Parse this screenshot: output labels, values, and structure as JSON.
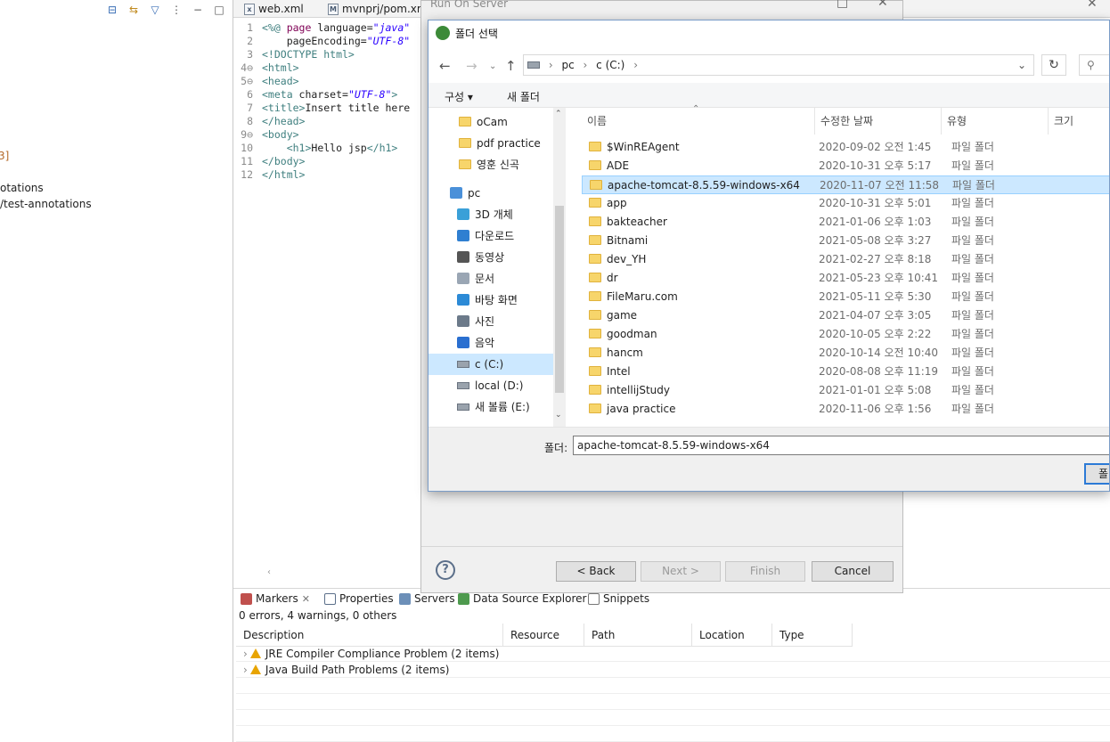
{
  "left_panel": {
    "items": [
      "3]",
      "otations",
      "/test-annotations"
    ]
  },
  "editor": {
    "tabs": [
      "web.xml",
      "mvnprj/pom.xm"
    ],
    "lines": [
      {
        "num": "1",
        "segments": [
          [
            "tag",
            "<%@ "
          ],
          [
            "kw",
            "page "
          ],
          [
            "",
            "language="
          ],
          [
            "str",
            "\"java\""
          ]
        ]
      },
      {
        "num": "2",
        "segments": [
          [
            "",
            "    pageEncoding="
          ],
          [
            "str",
            "\"UTF-8\""
          ]
        ]
      },
      {
        "num": "3",
        "segments": [
          [
            "tag",
            "<!DOCTYPE html>"
          ]
        ]
      },
      {
        "num": "4⊖",
        "segments": [
          [
            "tag",
            "<html>"
          ]
        ]
      },
      {
        "num": "5⊖",
        "segments": [
          [
            "tag",
            "<head>"
          ]
        ]
      },
      {
        "num": "6",
        "segments": [
          [
            "tag",
            "<meta "
          ],
          [
            "",
            "charset="
          ],
          [
            "str",
            "\"UTF-8\""
          ],
          [
            "tag",
            ">"
          ]
        ]
      },
      {
        "num": "7",
        "segments": [
          [
            "tag",
            "<title>"
          ],
          [
            "",
            "Insert title here"
          ]
        ]
      },
      {
        "num": "8",
        "segments": [
          [
            "tag",
            "</head>"
          ]
        ]
      },
      {
        "num": "9⊖",
        "segments": [
          [
            "tag",
            "<body>"
          ]
        ]
      },
      {
        "num": "10",
        "segments": [
          [
            "",
            "    "
          ],
          [
            "tag",
            "<h1>"
          ],
          [
            "",
            "Hello jsp"
          ],
          [
            "tag",
            "</h1>"
          ]
        ]
      },
      {
        "num": "11",
        "segments": [
          [
            "tag",
            "</body>"
          ]
        ]
      },
      {
        "num": "12",
        "segments": [
          [
            "tag",
            "</html>"
          ]
        ]
      }
    ]
  },
  "bottom": {
    "tabs": [
      "Markers",
      "Properties",
      "Servers",
      "Data Source Explorer",
      "Snippets"
    ],
    "summary": "0 errors, 4 warnings, 0 others",
    "columns": [
      "Description",
      "Resource",
      "Path",
      "Location",
      "Type"
    ],
    "rows": [
      "JRE Compiler Compliance Problem (2 items)",
      "Java Build Path Problems (2 items)"
    ]
  },
  "wizard": {
    "title": "Run On Server",
    "buttons": {
      "back": "< Back",
      "next": "Next >",
      "finish": "Finish",
      "cancel": "Cancel"
    }
  },
  "folder_dialog": {
    "title": "폴더 선택",
    "address": [
      "pc",
      "c (C:)"
    ],
    "search_placeholder": "",
    "commands": {
      "organize": "구성 ▾",
      "new_folder": "새 폴더"
    },
    "nav_items": [
      {
        "label": "oCam",
        "icon": "folder-icon"
      },
      {
        "label": "pdf practice",
        "icon": "folder-icon"
      },
      {
        "label": "영훈 신곡",
        "icon": "folder-icon"
      },
      {
        "label": "pc",
        "icon": "pc-icon"
      },
      {
        "label": "3D 개체",
        "icon": "3d-objects-icon"
      },
      {
        "label": "다운로드",
        "icon": "downloads-icon"
      },
      {
        "label": "동영상",
        "icon": "videos-icon"
      },
      {
        "label": "문서",
        "icon": "documents-icon"
      },
      {
        "label": "바탕 화면",
        "icon": "desktop-icon"
      },
      {
        "label": "사진",
        "icon": "pictures-icon"
      },
      {
        "label": "음악",
        "icon": "music-icon"
      },
      {
        "label": "c (C:)",
        "icon": "drive-icon"
      },
      {
        "label": "local (D:)",
        "icon": "drive-icon"
      },
      {
        "label": "새 볼륨 (E:)",
        "icon": "drive-icon"
      }
    ],
    "columns": {
      "name": "이름",
      "date": "수정한 날짜",
      "type": "유형",
      "size": "크기"
    },
    "files": [
      {
        "name": "$WinREAgent",
        "date": "2020-09-02 오전 1:45",
        "type": "파일 폴더"
      },
      {
        "name": "ADE",
        "date": "2020-10-31 오후 5:17",
        "type": "파일 폴더"
      },
      {
        "name": "apache-tomcat-8.5.59-windows-x64",
        "date": "2020-11-07 오전 11:58",
        "type": "파일 폴더"
      },
      {
        "name": "app",
        "date": "2020-10-31 오후 5:01",
        "type": "파일 폴더"
      },
      {
        "name": "bakteacher",
        "date": "2021-01-06 오후 1:03",
        "type": "파일 폴더"
      },
      {
        "name": "Bitnami",
        "date": "2021-05-08 오후 3:27",
        "type": "파일 폴더"
      },
      {
        "name": "dev_YH",
        "date": "2021-02-27 오후 8:18",
        "type": "파일 폴더"
      },
      {
        "name": "dr",
        "date": "2021-05-23 오후 10:41",
        "type": "파일 폴더"
      },
      {
        "name": "FileMaru.com",
        "date": "2021-05-11 오후 5:30",
        "type": "파일 폴더"
      },
      {
        "name": "game",
        "date": "2021-04-07 오후 3:05",
        "type": "파일 폴더"
      },
      {
        "name": "goodman",
        "date": "2020-10-05 오후 2:22",
        "type": "파일 폴더"
      },
      {
        "name": "hancm",
        "date": "2020-10-14 오전 10:40",
        "type": "파일 폴더"
      },
      {
        "name": "Intel",
        "date": "2020-08-08 오후 11:19",
        "type": "파일 폴더"
      },
      {
        "name": "intellijStudy",
        "date": "2021-01-01 오후 5:08",
        "type": "파일 폴더"
      },
      {
        "name": "java practice",
        "date": "2020-11-06 오후 1:56",
        "type": "파일 폴더"
      }
    ],
    "selected_file": "apache-tomcat-8.5.59-windows-x64",
    "selected_nav": "c (C:)",
    "folder_label": "폴더:",
    "folder_value": "apache-tomcat-8.5.59-windows-x64",
    "ok_label": "폴"
  }
}
